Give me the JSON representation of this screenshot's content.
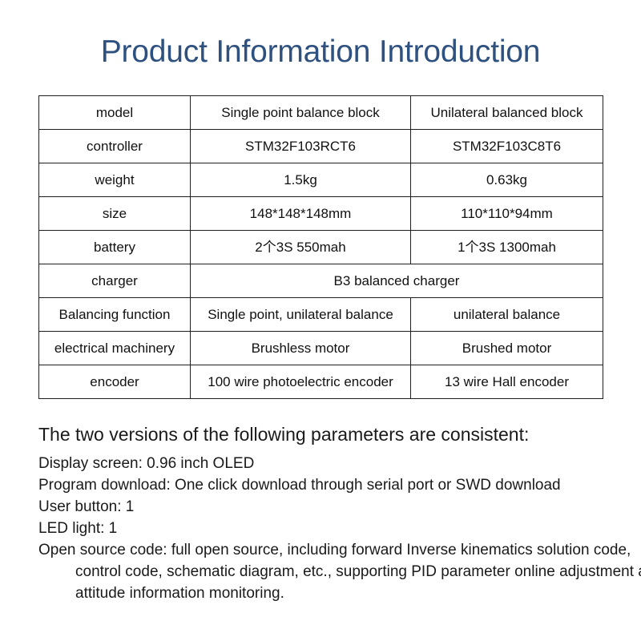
{
  "document": {
    "title": "Product Information Introduction",
    "title_color": "#2f5180",
    "background_color": "#ffffff",
    "text_color": "#1a1a1a",
    "table_border_color": "#1e1e1e"
  },
  "spec_table": {
    "rows": [
      {
        "label": "model",
        "value_a": "Single point balance block",
        "value_b": "Unilateral balanced block",
        "span": false
      },
      {
        "label": "controller",
        "value_a": "STM32F103RCT6",
        "value_b": "STM32F103C8T6",
        "span": false
      },
      {
        "label": "weight",
        "value_a": "1.5kg",
        "value_b": "0.63kg",
        "span": false
      },
      {
        "label": "size",
        "value_a": "148*148*148mm",
        "value_b": "110*110*94mm",
        "span": false
      },
      {
        "label": "battery",
        "value_a": "2个3S 550mah",
        "value_b": "1个3S 1300mah",
        "span": false
      },
      {
        "label": "charger",
        "value_a": "B3 balanced charger",
        "value_b": "",
        "span": true
      },
      {
        "label": "Balancing function",
        "value_a": "Single point, unilateral balance",
        "value_b": "unilateral balance",
        "span": false
      },
      {
        "label": "electrical machinery",
        "value_a": "Brushless motor",
        "value_b": "Brushed motor",
        "span": false
      },
      {
        "label": "encoder",
        "value_a": "100 wire photoelectric encoder",
        "value_b": "13 wire Hall encoder",
        "span": false
      }
    ]
  },
  "notes": {
    "heading": "The two versions of the following parameters are consistent:",
    "lines": [
      "Display screen: 0.96 inch OLED",
      "Program download: One click download through serial port or SWD download",
      "User button: 1",
      "LED light: 1",
      "Open source code: full open source, including forward Inverse kinematics solution code, control code, schematic diagram, etc., supporting PID parameter online adjustment and attitude information monitoring."
    ]
  }
}
